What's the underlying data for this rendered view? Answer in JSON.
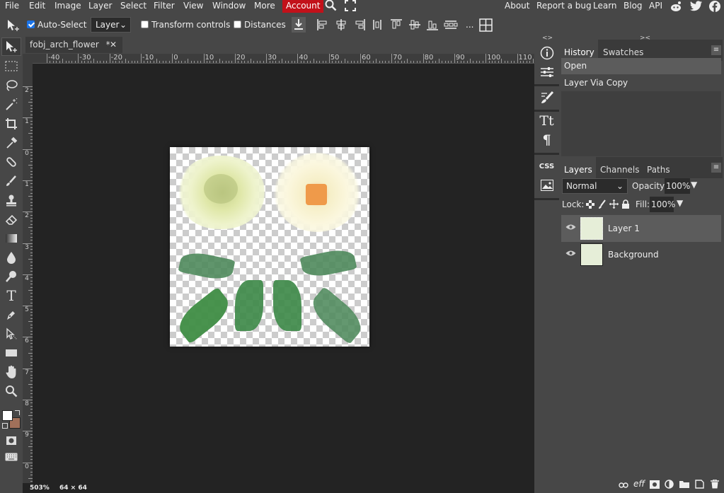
{
  "menu": {
    "items": [
      "File",
      "Edit",
      "Image",
      "Layer",
      "Select",
      "Filter",
      "View",
      "Window",
      "More"
    ],
    "account": "Account",
    "right_links": [
      "About",
      "Report a bug",
      "Learn",
      "Blog",
      "API"
    ]
  },
  "options": {
    "auto_select_label": "Auto-Select",
    "auto_select_checked": true,
    "target_value": "Layer",
    "transform_controls_label": "Transform controls",
    "distances_label": "Distances",
    "more_label": "..."
  },
  "document": {
    "tab_title": "fobj_arch_flower",
    "modified_marker": "*",
    "close_label": "✕",
    "zoom": "503%",
    "size": "64 × 64"
  },
  "rulers": {
    "top": [
      "-40",
      "-30",
      "-20",
      "-10",
      "0",
      "10",
      "20",
      "30",
      "40",
      "50",
      "60",
      "70",
      "80",
      "90",
      "100",
      "110"
    ],
    "left": [
      "2",
      "1",
      "0",
      "1",
      "2",
      "3",
      "4",
      "5",
      "6",
      "7",
      "8",
      "9",
      "0"
    ]
  },
  "history_panel": {
    "tabs": [
      "History",
      "Swatches"
    ],
    "items": [
      "Open",
      "Layer Via Copy"
    ]
  },
  "layers_panel": {
    "tabs": [
      "Layers",
      "Channels",
      "Paths"
    ],
    "blend_mode": "Normal",
    "opacity_label": "Opacity:",
    "opacity_value": "100%",
    "lock_label": "Lock:",
    "fill_label": "Fill:",
    "fill_value": "100%",
    "layers": [
      {
        "name": "Layer 1",
        "selected": true
      },
      {
        "name": "Background",
        "selected": false
      }
    ]
  },
  "colors": {
    "foreground": "#ffffff",
    "background": "#a0705a",
    "account_red": "#c2111a",
    "panel_bg": "#474747",
    "workspace_bg": "#232323"
  },
  "icons": {
    "tools": [
      "move-tool-icon",
      "marquee-tool-icon",
      "lasso-tool-icon",
      "magic-wand-icon",
      "crop-tool-icon",
      "eyedropper-icon",
      "healing-brush-icon",
      "brush-tool-icon",
      "clone-stamp-icon",
      "eraser-icon",
      "gradient-tool-icon",
      "blur-tool-icon",
      "dodge-tool-icon",
      "type-tool-icon",
      "pen-tool-icon",
      "path-select-icon",
      "shape-tool-icon",
      "hand-tool-icon",
      "zoom-tool-icon"
    ],
    "social": [
      "reddit-icon",
      "twitter-icon",
      "facebook-icon"
    ]
  }
}
